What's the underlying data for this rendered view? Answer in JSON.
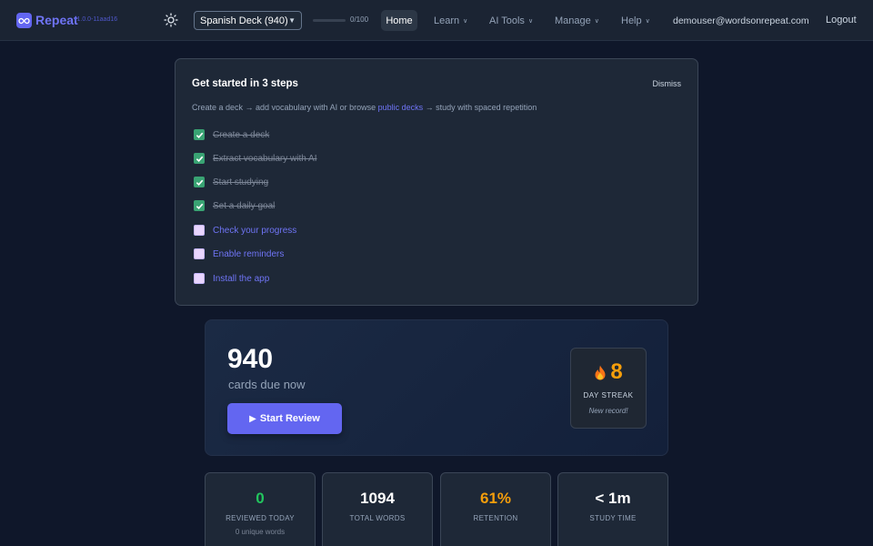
{
  "header": {
    "brand": "Repeat",
    "version": "v1.0.0-11aad16",
    "deck_select": {
      "selected": "Spanish Deck (940)"
    },
    "daily_progress": {
      "text": "0/100",
      "fraction": 0
    },
    "nav": {
      "home": "Home",
      "learn": "Learn",
      "ai_tools": "AI Tools",
      "manage": "Manage",
      "help": "Help"
    },
    "user_email": "demouser@wordsonrepeat.com",
    "logout": "Logout"
  },
  "onboarding": {
    "title": "Get started in 3 steps",
    "dismiss": "Dismiss",
    "subtitle_before": "Create a deck → add vocabulary with AI or browse ",
    "subtitle_link": "public decks",
    "subtitle_after": " → study with spaced repetition",
    "steps": [
      {
        "label": "Create a deck",
        "done": true
      },
      {
        "label": "Extract vocabulary with AI",
        "done": true
      },
      {
        "label": "Start studying",
        "done": true
      },
      {
        "label": "Set a daily goal",
        "done": true
      },
      {
        "label": "Check your progress",
        "done": false
      },
      {
        "label": "Enable reminders",
        "done": false
      },
      {
        "label": "Install the app",
        "done": false
      }
    ]
  },
  "due": {
    "count": "940",
    "label": "cards due now",
    "start_button": "Start Review"
  },
  "streak": {
    "value": "8",
    "label": "DAY STREAK",
    "note": "New record!"
  },
  "stats": {
    "reviewed_today": {
      "value": "0",
      "label": "REVIEWED TODAY",
      "sub": "0 unique words",
      "color": "#22c55e"
    },
    "total_words": {
      "value": "1094",
      "label": "TOTAL WORDS",
      "color": "#ffffff"
    },
    "retention": {
      "value": "61%",
      "label": "RETENTION",
      "color": "#f59e0b"
    },
    "study_time": {
      "value": "< 1m",
      "label": "STUDY TIME",
      "color": "#ffffff"
    }
  },
  "colors": {
    "accent": "#6366f1",
    "background": "#0f172a",
    "done_check": "#39a373",
    "streak": "#f59e0b"
  }
}
